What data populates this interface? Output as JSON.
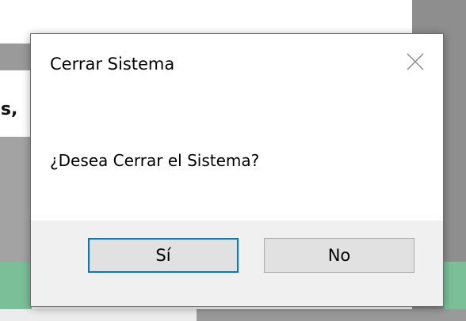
{
  "dialog": {
    "title": "Cerrar Sistema",
    "message": "¿Desea Cerrar el Sistema?",
    "close_icon": "close-icon",
    "buttons": {
      "yes_label": "Sí",
      "no_label": "No"
    },
    "accent_color": "#0078d7"
  },
  "background": {
    "partial_text": "es,"
  }
}
